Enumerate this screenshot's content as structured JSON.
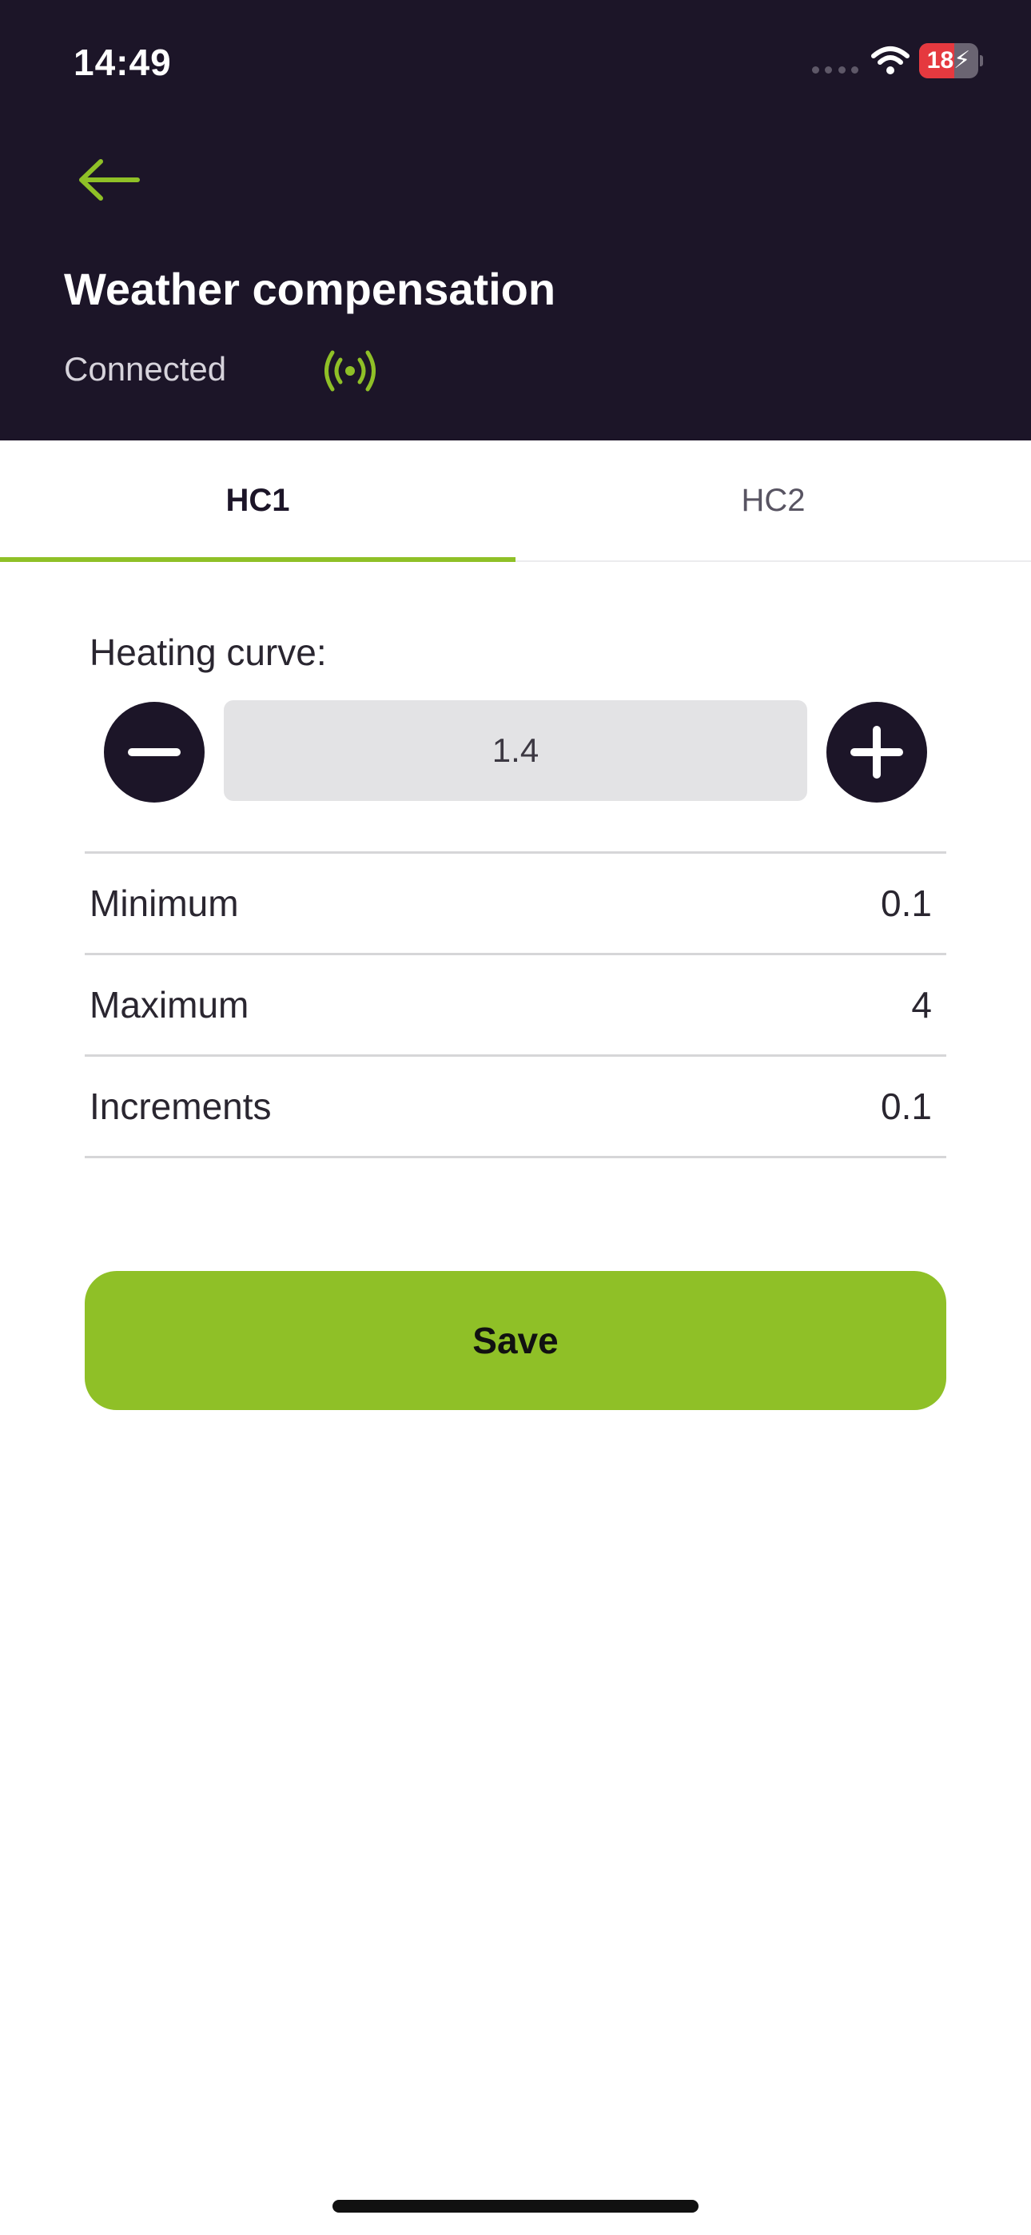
{
  "status_bar": {
    "time": "14:49",
    "battery_level": 18,
    "battery_label": "18⚡",
    "battery_color": "#e5393f",
    "icons": [
      "cellular-dots-icon",
      "wifi-icon",
      "battery-charging-icon"
    ]
  },
  "header": {
    "back_icon": "arrow-left-icon",
    "title": "Weather compensation",
    "connection_status": "Connected",
    "connection_icon": "broadcast-signal-icon",
    "background_color": "#1c1528",
    "accent_color": "#8fc027"
  },
  "tabs": [
    {
      "label": "HC1",
      "selected": true
    },
    {
      "label": "HC2",
      "selected": false
    }
  ],
  "heating_curve": {
    "label": "Heating curve:",
    "value": "1.4",
    "decrement_icon": "minus-circle-icon",
    "increment_icon": "plus-circle-icon"
  },
  "limits": [
    {
      "label": "Minimum",
      "value": "0.1"
    },
    {
      "label": "Maximum",
      "value": "4"
    },
    {
      "label": "Increments",
      "value": "0.1"
    }
  ],
  "save_label": "Save"
}
